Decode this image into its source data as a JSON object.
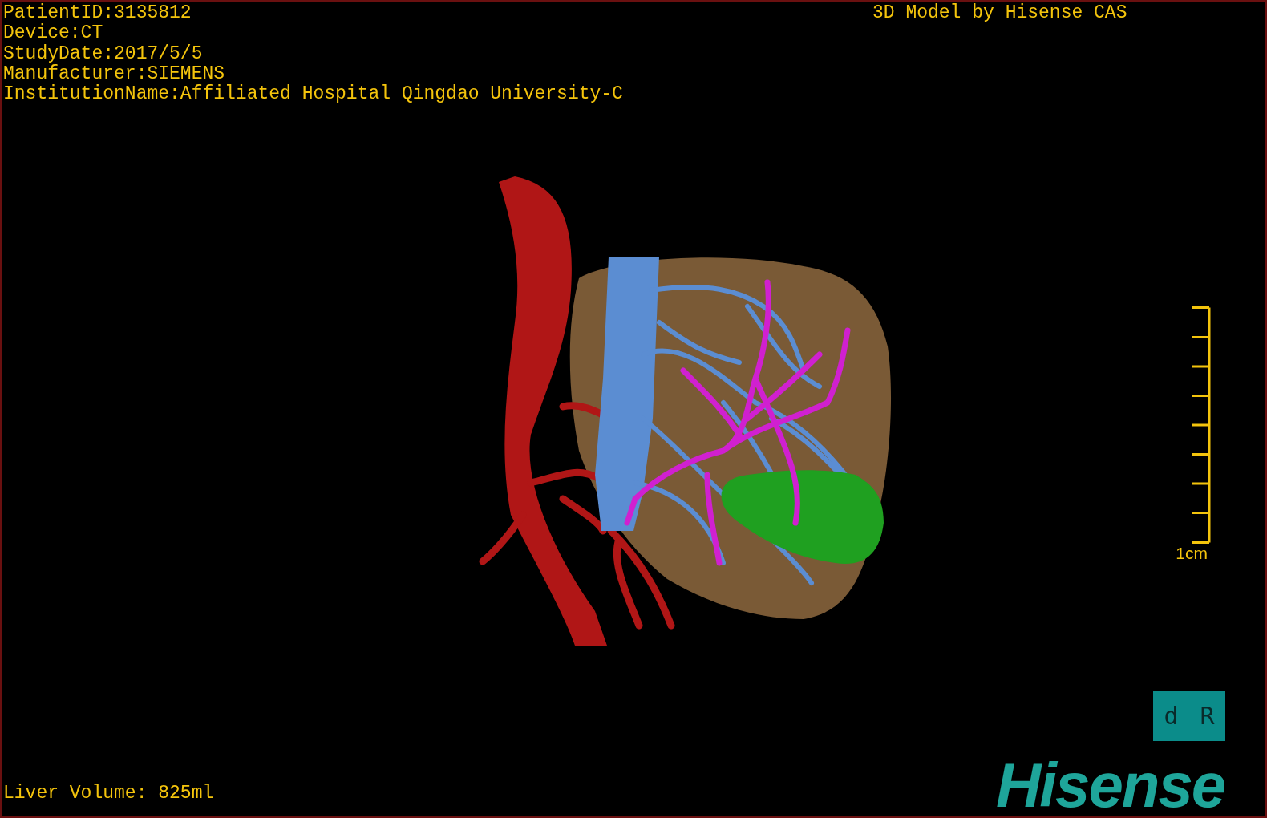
{
  "patient_info": [
    "PatientID:3135812",
    "Device:CT",
    "StudyDate:2017/5/5",
    "Manufacturer:SIEMENS",
    "InstitutionName:Affiliated Hospital Qingdao University-C"
  ],
  "model_title": "3D Model by Hisense CAS",
  "scale_bar": {
    "label": "1cm"
  },
  "orientation_cube": {
    "labels": [
      "d",
      "R"
    ]
  },
  "liver_volume": "Liver Volume: 825ml",
  "logo": "Hisense"
}
